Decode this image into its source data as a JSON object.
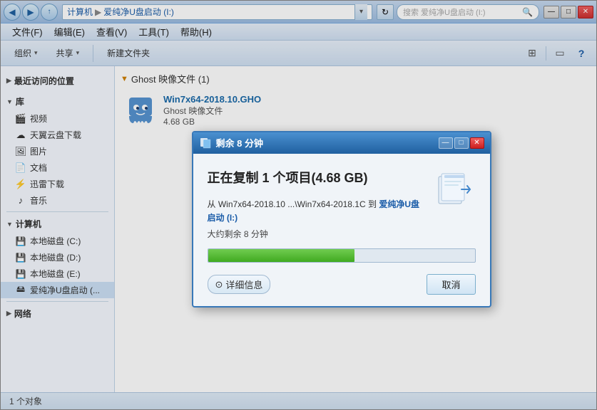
{
  "window": {
    "title": "爱纯净U盘启动 (I:)",
    "controls": {
      "minimize": "—",
      "maximize": "□",
      "close": "✕"
    }
  },
  "titlebar": {
    "back_btn": "◀",
    "forward_btn": "▶",
    "up_btn": "▲",
    "address_parts": [
      "计算机",
      "爱纯净U盘启动 (I:)"
    ],
    "dropdown_arrow": "▾",
    "refresh_arrow": "↻",
    "search_placeholder": "搜索 爱纯净U盘启动 (I:)",
    "search_icon": "🔍"
  },
  "menubar": {
    "items": [
      "文件(F)",
      "编辑(E)",
      "查看(V)",
      "工具(T)",
      "帮助(H)"
    ]
  },
  "toolbar": {
    "organize_label": "组织",
    "share_label": "共享",
    "new_folder_label": "新建文件夹",
    "dropdown_arrow": "▾",
    "view_icon": "⊞",
    "help_icon": "?"
  },
  "sidebar": {
    "recent_section": "最近访问的位置",
    "library_section": "库",
    "library_items": [
      {
        "label": "视频",
        "icon": "🎬"
      },
      {
        "label": "天翼云盘下载",
        "icon": "☁"
      },
      {
        "label": "图片",
        "icon": "🖼"
      },
      {
        "label": "文档",
        "icon": "📄"
      },
      {
        "label": "迅雷下载",
        "icon": "⚡"
      },
      {
        "label": "音乐",
        "icon": "♪"
      }
    ],
    "computer_section": "计算机",
    "computer_items": [
      {
        "label": "本地磁盘 (C:)",
        "icon": "💾"
      },
      {
        "label": "本地磁盘 (D:)",
        "icon": "💾"
      },
      {
        "label": "本地磁盘 (E:)",
        "icon": "💾"
      },
      {
        "label": "爱纯净U盘启动 (...",
        "icon": "🖴",
        "active": true
      }
    ],
    "network_section": "网络"
  },
  "file_area": {
    "breadcrumb": "Ghost 映像文件 (1)",
    "folder_header": "Ghost 映像文件 (1)",
    "files": [
      {
        "name": "Win7x64-2018.10.GHO",
        "type": "Ghost 映像文件",
        "size": "4.68 GB"
      }
    ]
  },
  "statusbar": {
    "count": "1 个对象"
  },
  "dialog": {
    "title": "剩余 8 分钟",
    "main_text": "正在复制 1 个项目(4.68 GB)",
    "from_label": "从",
    "from_path": "Win7x64-2018.10 ...\\Win7x64-2018.1C",
    "to_label": "到",
    "to_destination": "爱纯净U盘启动 (I:)",
    "remaining": "大约剩余 8 分钟",
    "progress_percent": 55,
    "details_label": "详细信息",
    "cancel_label": "取消",
    "controls": {
      "minimize": "—",
      "maximize": "□",
      "close": "✕"
    }
  }
}
